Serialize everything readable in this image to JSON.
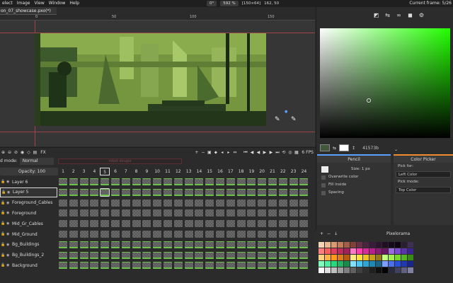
{
  "menubar": {
    "items": [
      "elect",
      "Image",
      "View",
      "Window",
      "Help"
    ],
    "rotation": "0°",
    "zoom": "592 %",
    "size": "[150×64]",
    "coords": "162, 50",
    "current_frame": "Current frame: 5/26"
  },
  "document_tab": "on_07_showcase.pxo(*)",
  "ruler": {
    "labels": [
      "0",
      "50",
      "100",
      "150"
    ]
  },
  "right_panel": {
    "tools": [
      "pipette-icon",
      "mirror-icon",
      "link-icon",
      "palette-icon",
      "settings-icon"
    ],
    "hex": "41573b",
    "colors": {
      "primary": "#41573b",
      "secondary": "#ffffff",
      "picker_hue": "#22ff00"
    }
  },
  "tool_options": {
    "left": {
      "title": "Pencil",
      "size_label": "Size: 1 px",
      "options": [
        "Overwrite color",
        "Fill inside",
        "Spacing"
      ]
    },
    "right": {
      "title": "Color Picker",
      "pick_for_label": "Pick for:",
      "pick_for_value": "Left Color",
      "pick_mode_label": "Pick mode:",
      "pick_mode_value": "Top Color"
    }
  },
  "palette": {
    "name": "Pixelorama",
    "colors": [
      "#f5d5b5",
      "#e8b890",
      "#d79a73",
      "#c27c58",
      "#a35e46",
      "#843f3a",
      "#683047",
      "#4e2340",
      "#3a1a3a",
      "#2b1530",
      "#1f0f25",
      "#150a1b",
      "#0d0612",
      "#2a1f30",
      "#3e3050",
      "#ff7f7f",
      "#ff5c5c",
      "#e04060",
      "#c02a5a",
      "#a0205a",
      "#ff77c7",
      "#ff3fae",
      "#d92a9b",
      "#b81f8a",
      "#8a1a76",
      "#6a1863",
      "#9a6ae0",
      "#7a4ad0",
      "#5a34b0",
      "#3a2490",
      "#ffd27f",
      "#ffb347",
      "#ff9a1f",
      "#e07b1a",
      "#b85c14",
      "#ffe97f",
      "#ffe03f",
      "#f0c020",
      "#c8a018",
      "#9a7a12",
      "#c0ff7f",
      "#a0f04a",
      "#7ad82a",
      "#55b51f",
      "#3a8a18",
      "#7fffbf",
      "#4af0a0",
      "#2ad880",
      "#1fb564",
      "#188a4a",
      "#7fe0ff",
      "#4ac8f0",
      "#2aa8d8",
      "#1f88b5",
      "#18668a",
      "#7f9fff",
      "#4a70f0",
      "#2a50d8",
      "#1f38b5",
      "#18268a",
      "#ffffff",
      "#e0e0e0",
      "#c0c0c0",
      "#a0a0a0",
      "#808080",
      "#606060",
      "#404040",
      "#303030",
      "#202020",
      "#101010",
      "#000000",
      "#2a2a40",
      "#404060",
      "#606080",
      "#8080a0"
    ]
  },
  "timeline": {
    "blend_mode_label": "d mode:",
    "blend_mode_value": "Normal",
    "opacity": "Opacity: 100",
    "tag": "robot dougie",
    "fps": "6 FPS",
    "frames": [
      "1",
      "2",
      "3",
      "4",
      "5",
      "6",
      "7",
      "8",
      "9",
      "10",
      "11",
      "12",
      "13",
      "14",
      "15",
      "16",
      "17",
      "18",
      "19",
      "20",
      "21",
      "22",
      "23",
      "24"
    ],
    "current_frame_index": 4,
    "layers": [
      {
        "name": "Layer 6",
        "selected": false
      },
      {
        "name": "Layer 5",
        "selected": true
      },
      {
        "name": "Foreground_Cables",
        "selected": false
      },
      {
        "name": "Foreground",
        "selected": false
      },
      {
        "name": "Mid_Gr_Cables",
        "selected": false
      },
      {
        "name": "Mid_Ground",
        "selected": false
      },
      {
        "name": "Bg_Buildings",
        "selected": false
      },
      {
        "name": "Bg_Buildings_2",
        "selected": false
      },
      {
        "name": "Background",
        "selected": false
      }
    ]
  }
}
